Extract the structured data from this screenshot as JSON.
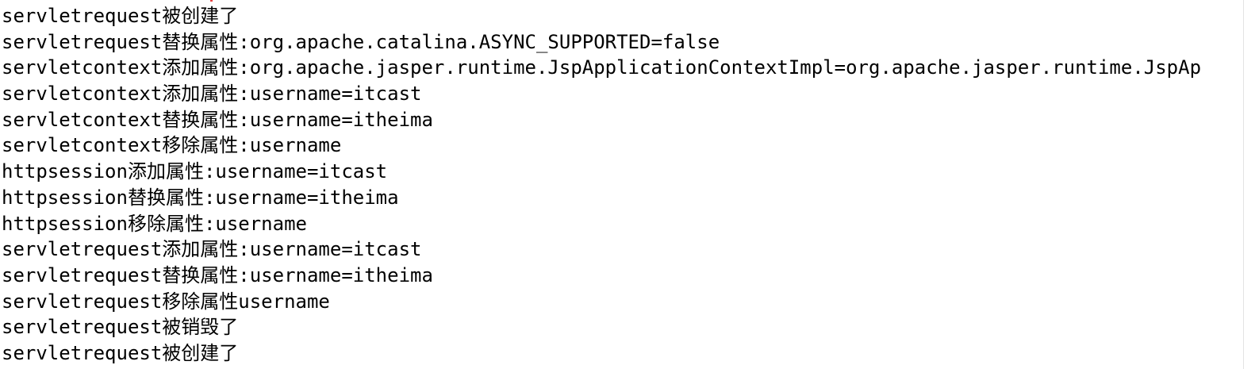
{
  "console": {
    "lines": [
      "servletrequest被创建了",
      "servletrequest替换属性:org.apache.catalina.ASYNC_SUPPORTED=false",
      "servletcontext添加属性:org.apache.jasper.runtime.JspApplicationContextImpl=org.apache.jasper.runtime.JspAp",
      "servletcontext添加属性:username=itcast",
      "servletcontext替换属性:username=itheima",
      "servletcontext移除属性:username",
      "httpsession添加属性:username=itcast",
      "httpsession替换属性:username=itheima",
      "httpsession移除属性:username",
      "servletrequest添加属性:username=itcast",
      "servletrequest替换属性:username=itheima",
      "servletrequest移除属性username",
      "servletrequest被销毁了",
      "servletrequest被创建了"
    ]
  },
  "colors": {
    "text": "#000000",
    "background": "#ffffff",
    "marker": "#e64040"
  }
}
